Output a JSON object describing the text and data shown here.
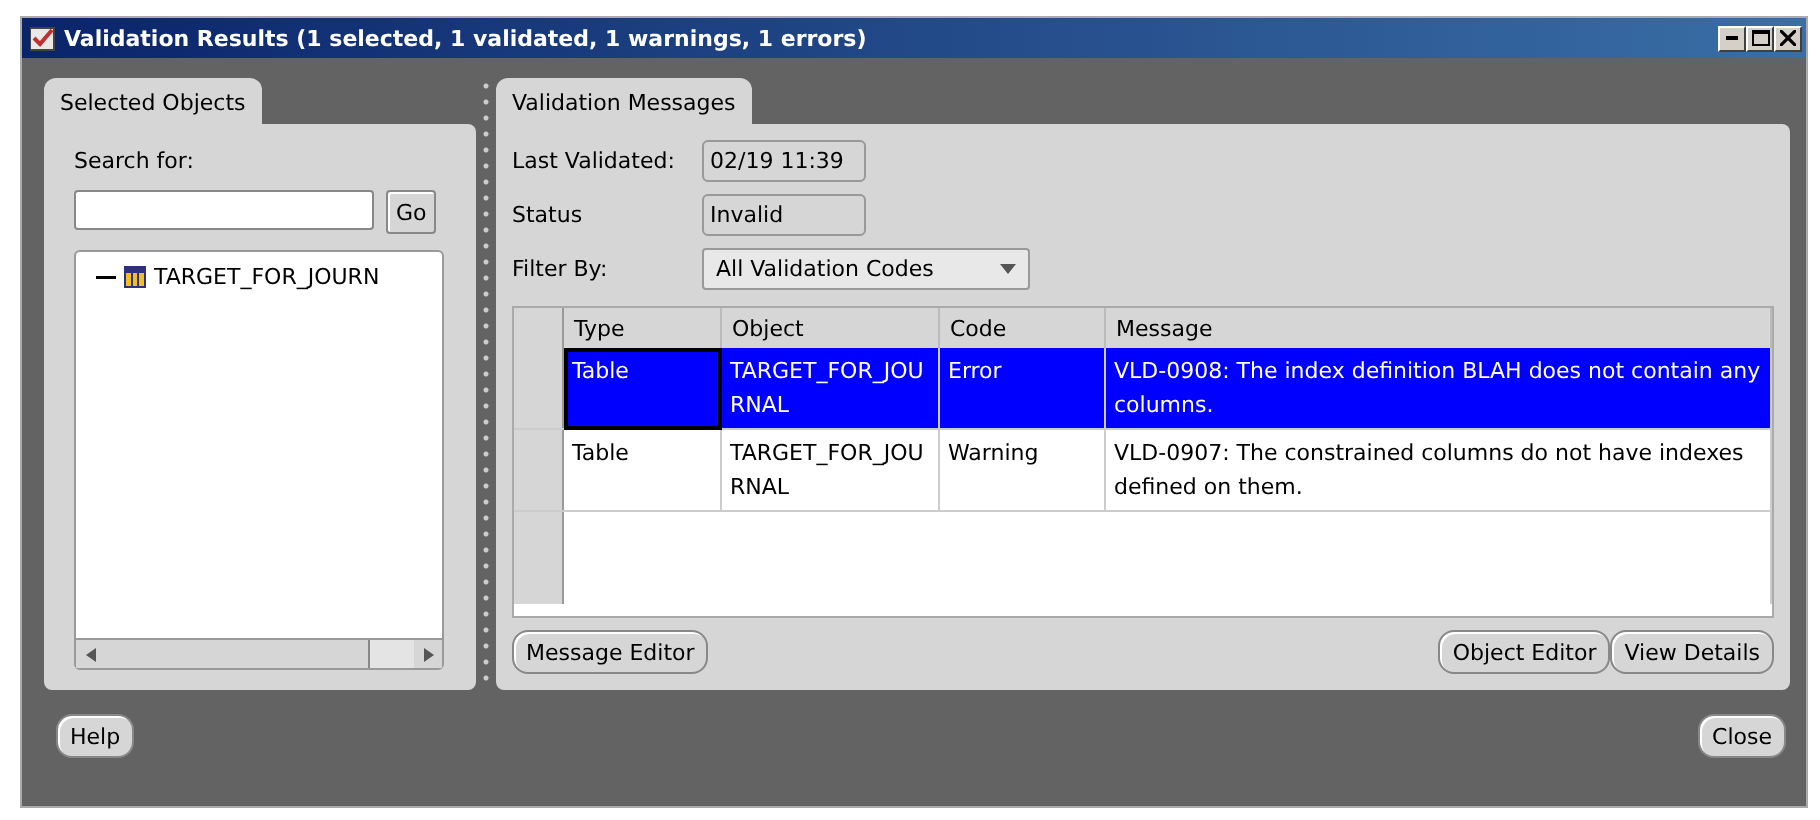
{
  "window": {
    "title": "Validation Results (1 selected, 1 validated, 1 warnings, 1 errors)"
  },
  "left_panel": {
    "tab": "Selected Objects",
    "search_label": "Search for:",
    "go_button": "Go",
    "tree": [
      {
        "label": "TARGET_FOR_JOURN",
        "expanded": true
      }
    ]
  },
  "right_panel": {
    "tab": "Validation Messages",
    "last_validated_label": "Last Validated:",
    "last_validated": "02/19 11:39",
    "status_label": "Status",
    "status": "Invalid",
    "filter_label": "Filter By:",
    "filter": "All Validation Codes",
    "table": {
      "columns": [
        "Type",
        "Object",
        "Code",
        "Message"
      ],
      "rows": [
        {
          "selected": true,
          "cells": [
            "Table",
            "TARGET_FOR_JOURNAL",
            "Error",
            "VLD-0908: The index definition BLAH does not contain any columns."
          ]
        },
        {
          "selected": false,
          "cells": [
            "Table",
            "TARGET_FOR_JOURNAL",
            "Warning",
            "VLD-0907: The constrained columns do not have indexes defined on them."
          ]
        }
      ]
    },
    "left_buttons": [
      "Message Editor"
    ],
    "right_buttons": [
      "Object Editor",
      "View Details"
    ]
  },
  "footer": {
    "left_buttons": [
      "Help"
    ],
    "right_buttons": [
      "Close"
    ]
  }
}
